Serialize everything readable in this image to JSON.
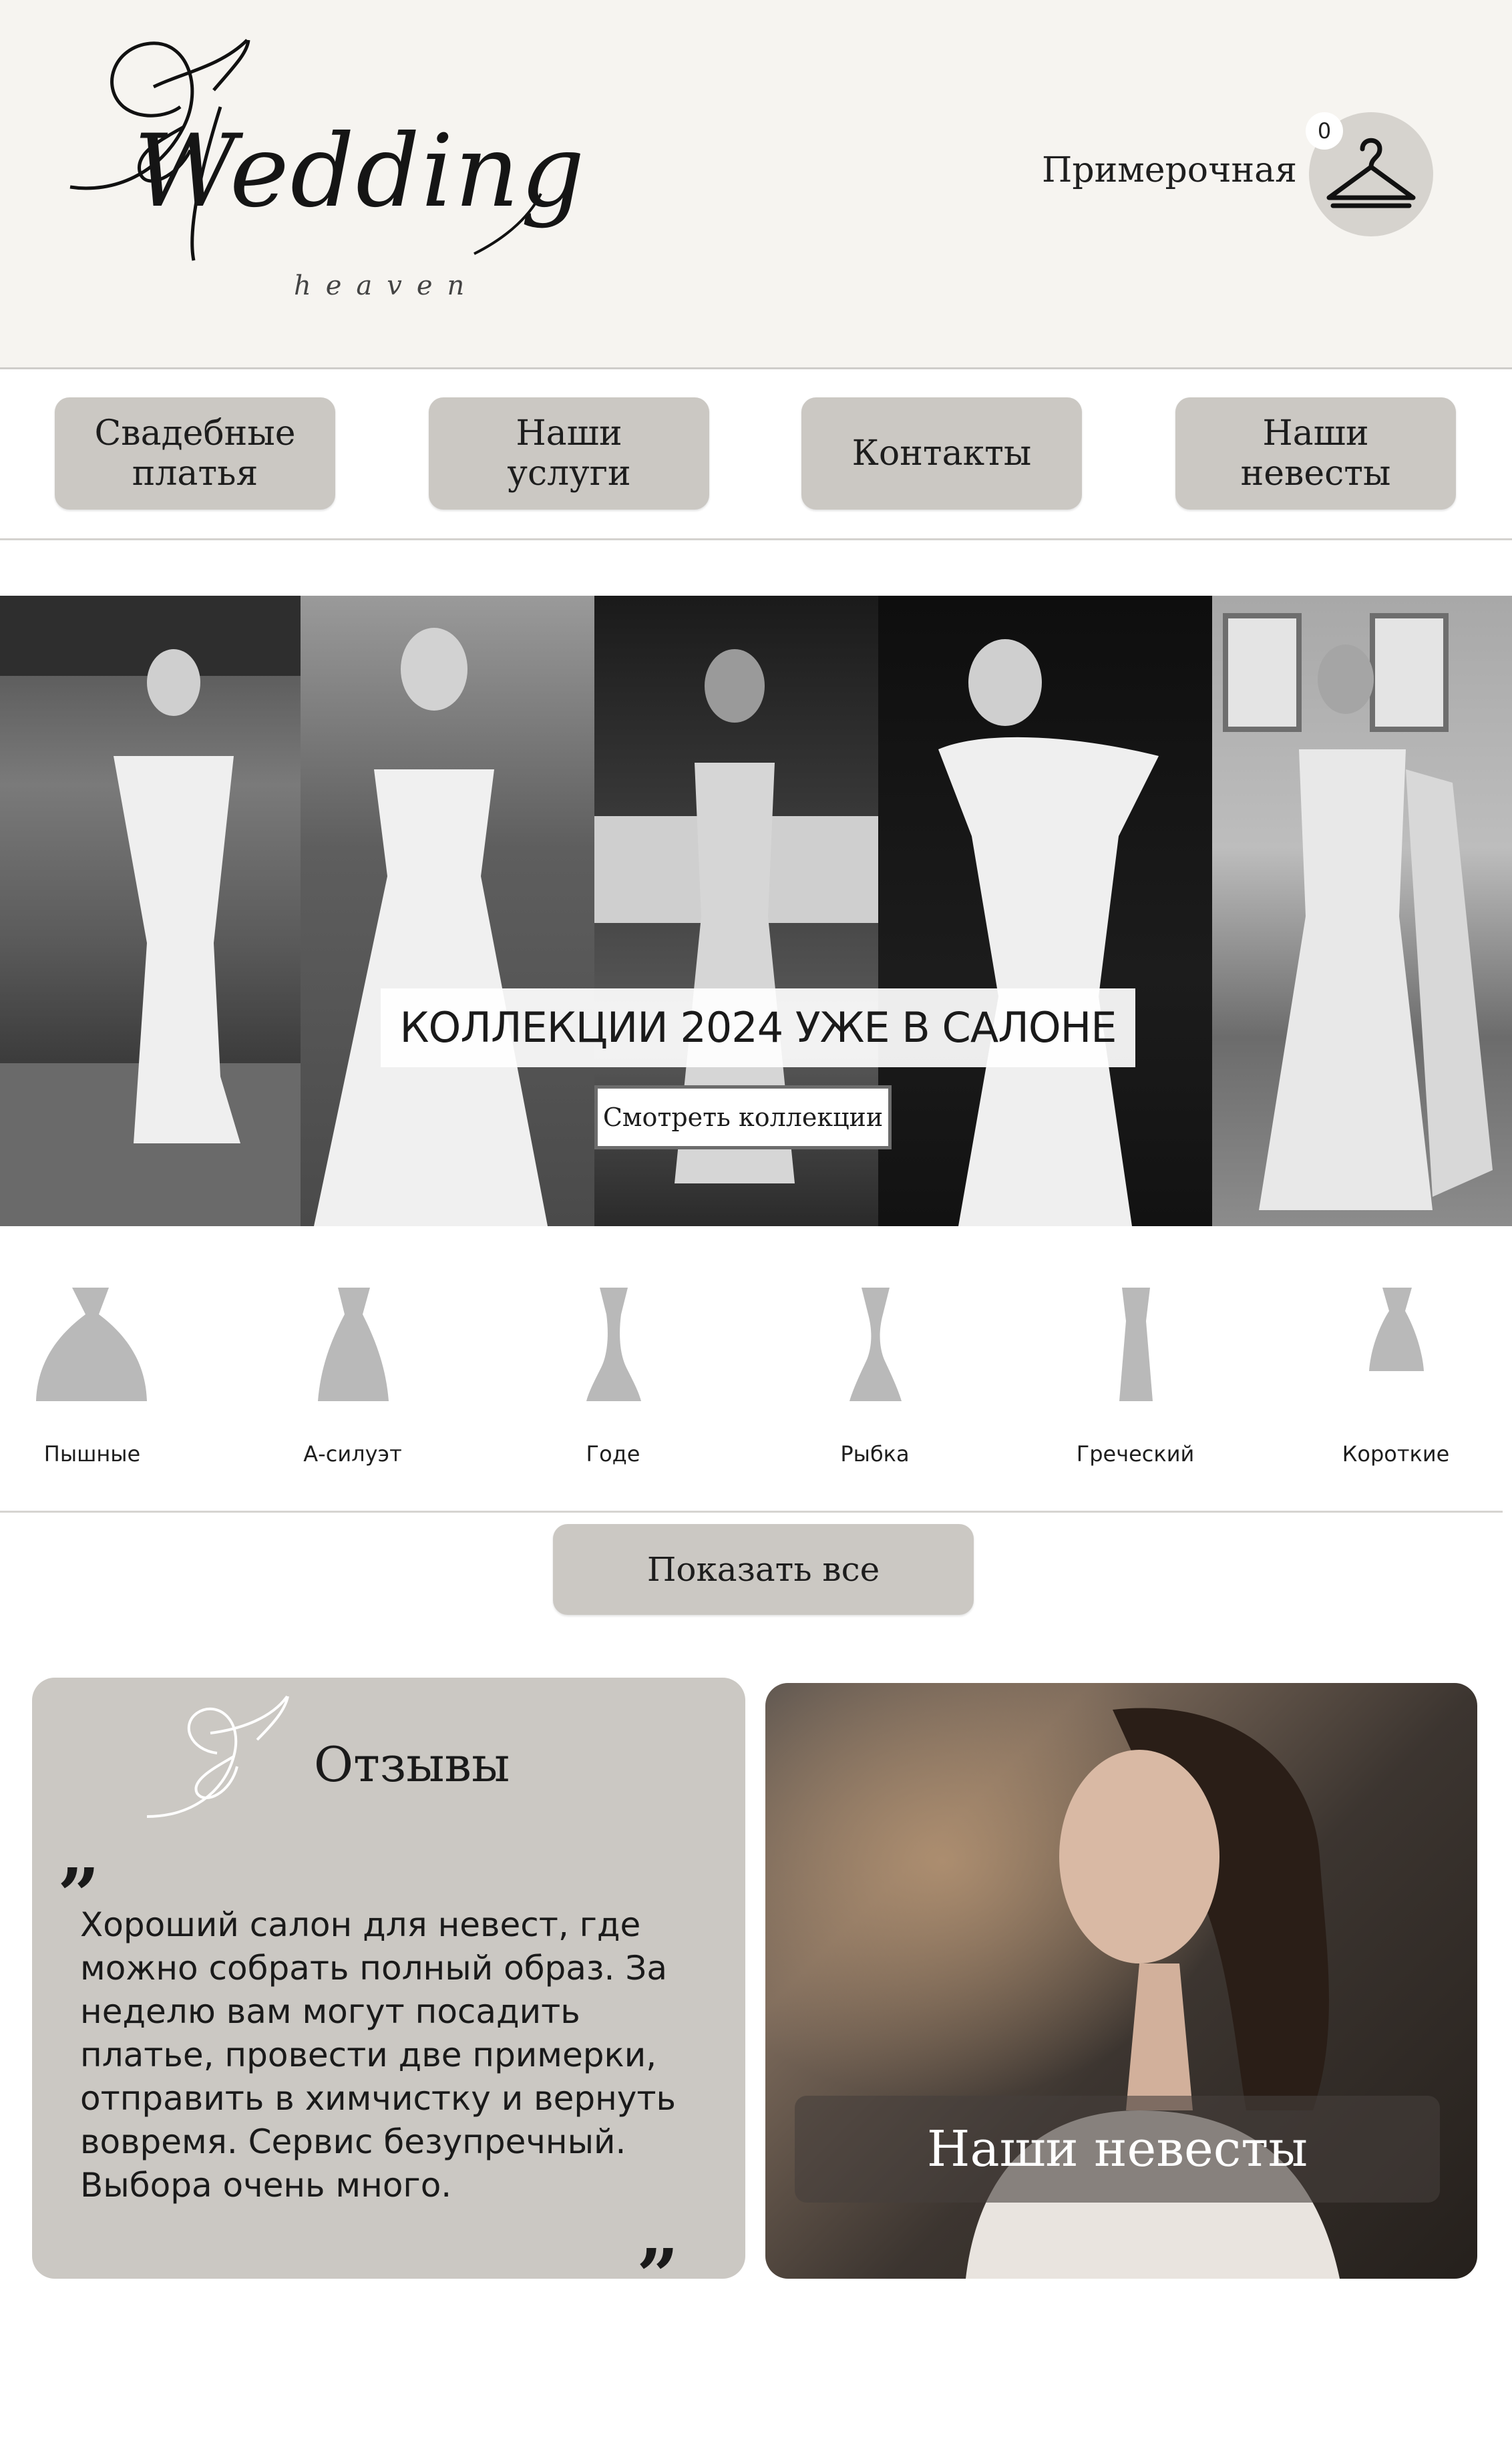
{
  "header": {
    "logo_main": "Wedding",
    "logo_sub": "heaven",
    "fitting_room_label": "Примерочная",
    "cart_count": "0",
    "cart_icon": "hanger-icon"
  },
  "nav": [
    {
      "label": "Свадебные\nплатья"
    },
    {
      "label": "Наши\nуслуги"
    },
    {
      "label": "Контакты"
    },
    {
      "label": "Наши\nневесты"
    }
  ],
  "banner": {
    "title": "КОЛЛЕКЦИИ 2024 УЖЕ В САЛОНЕ",
    "button_label": "Смотреть коллекции"
  },
  "silhouettes": [
    {
      "label": "Пышные",
      "icon": "ball-gown-icon"
    },
    {
      "label": "А-силуэт",
      "icon": "a-line-dress-icon"
    },
    {
      "label": "Годе",
      "icon": "godet-dress-icon"
    },
    {
      "label": "Рыбка",
      "icon": "mermaid-dress-icon"
    },
    {
      "label": "Греческий",
      "icon": "greek-dress-icon"
    },
    {
      "label": "Короткие",
      "icon": "short-dress-icon"
    }
  ],
  "show_all_label": "Показать все",
  "reviews": {
    "title": "Отзывы",
    "quote_open": "„",
    "quote_close": "„",
    "text": "Хороший салон для невест, где можно собрать полный образ. За неделю вам могут посадить платье, провести две примерки, отправить в химчистку и вернуть вовремя. Сервис безупречный. Выбора очень много."
  },
  "brides_card": {
    "label": "Наши невесты"
  },
  "colors": {
    "header_bg": "#f6f4f0",
    "button_bg": "#cbc8c3",
    "silhouette": "#b9b9b9"
  }
}
